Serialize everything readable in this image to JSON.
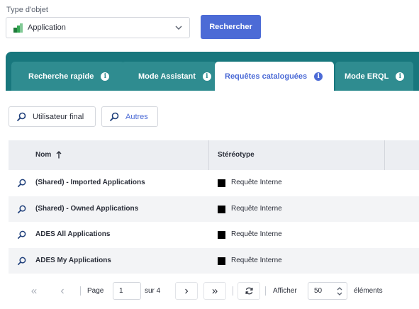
{
  "search": {
    "type_label": "Type d'objet",
    "type_value": "Application",
    "type_icon": "application-icon",
    "button_label": "Rechercher",
    "accent_color": "#4c6bd6"
  },
  "tabs": [
    {
      "label": "Recherche rapide",
      "active": false
    },
    {
      "label": "Mode Assistant",
      "active": false
    },
    {
      "label": "Requêtes cataloguées",
      "active": true
    },
    {
      "label": "Mode ERQL",
      "active": false
    }
  ],
  "tab_bar_color": "#18777d",
  "filters": [
    {
      "label": "Utilisateur final",
      "icon": "search-icon"
    },
    {
      "label": "Autres",
      "icon": "search-icon"
    }
  ],
  "table": {
    "columns": [
      "Nom",
      "Stéréotype"
    ],
    "sort_icon": "arrow-up-icon",
    "rows": [
      {
        "name": "(Shared) - Imported Applications",
        "stereotype": "Requête Interne"
      },
      {
        "name": "(Shared) - Owned Applications",
        "stereotype": "Requête Interne"
      },
      {
        "name": "ADES All Applications",
        "stereotype": "Requête Interne"
      },
      {
        "name": "ADES My Applications",
        "stereotype": "Requête Interne"
      }
    ]
  },
  "pager": {
    "first": "«",
    "prev": "‹",
    "page_label": "Page",
    "page_value": "1",
    "of_label": "sur 4",
    "next": "›",
    "last": "»",
    "show_label": "Afficher",
    "per_page": "50",
    "items_label": "éléments"
  }
}
